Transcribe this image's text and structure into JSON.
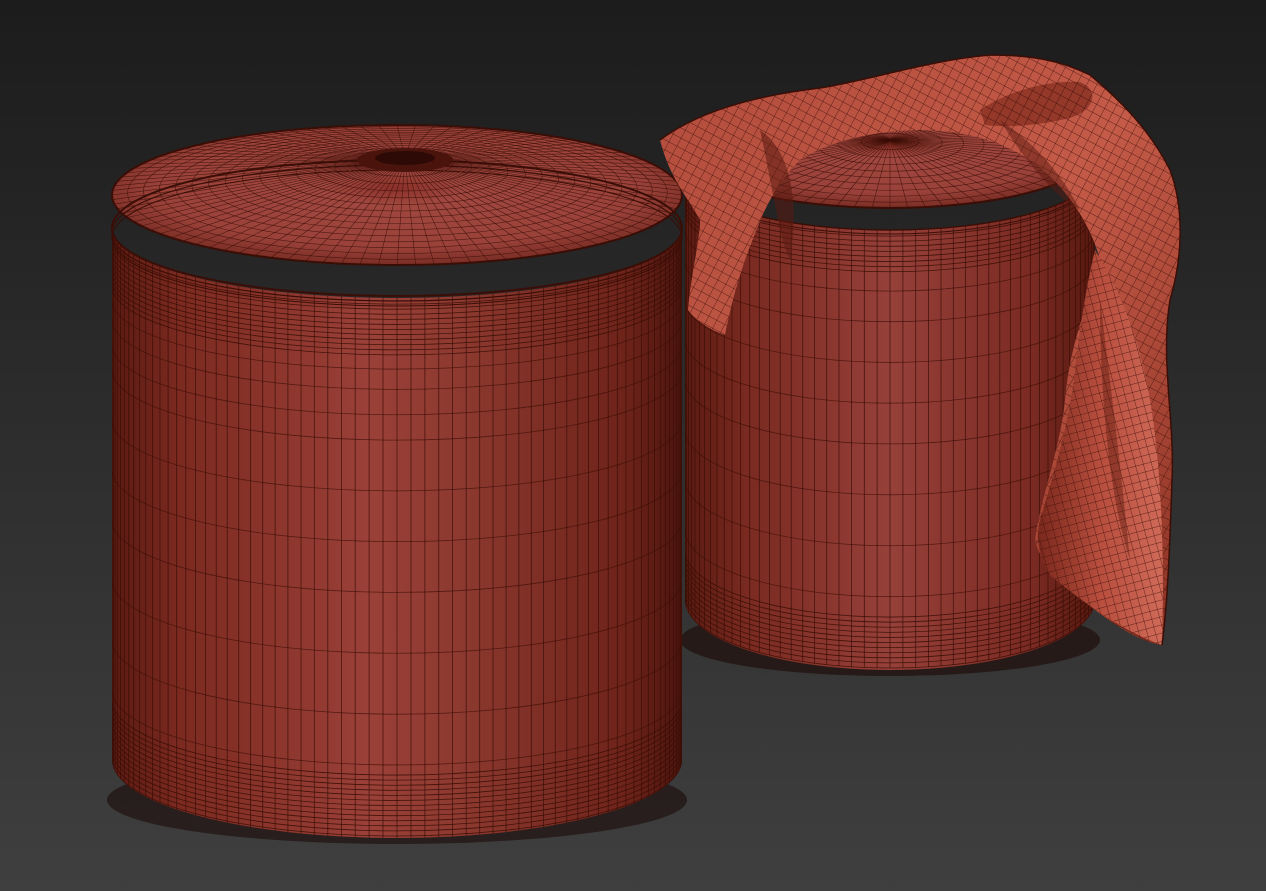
{
  "viewport": {
    "render_mode": "wireframe-on-shaded",
    "background_colors": [
      "#1c1c1c",
      "#3f3f3f"
    ],
    "wire_color": "#3a0e06"
  },
  "objects": [
    {
      "id": "pouf-left",
      "type": "cylindrical pouf",
      "shade_color": "#8a342c",
      "highlight_color": "#a0443a",
      "shadow_color": "#5a1a12"
    },
    {
      "id": "pouf-right",
      "type": "cylindrical pouf",
      "shade_color": "#8a342c",
      "highlight_color": "#a0443a",
      "shadow_color": "#5a1a12"
    },
    {
      "id": "cloth-throw",
      "type": "draped cloth",
      "shade_color": "#b04a3a",
      "highlight_color": "#c86050",
      "shadow_color": "#6a2015"
    }
  ]
}
